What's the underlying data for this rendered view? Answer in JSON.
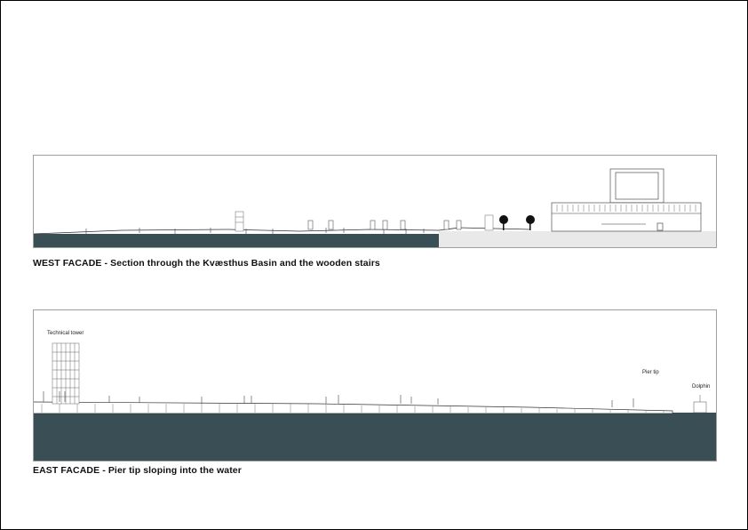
{
  "west": {
    "caption": "WEST FACADE - Section through the Kvæsthus Basin and the wooden stairs"
  },
  "east": {
    "caption": "EAST FACADE - Pier tip sloping into the water",
    "labels": {
      "tower": "Technical tower",
      "pier_tip": "Pier tip",
      "dolphin": "Dolphin"
    }
  },
  "colors": {
    "water": "#3a4f55",
    "ground": "#e9e9e9",
    "line": "#333333"
  }
}
